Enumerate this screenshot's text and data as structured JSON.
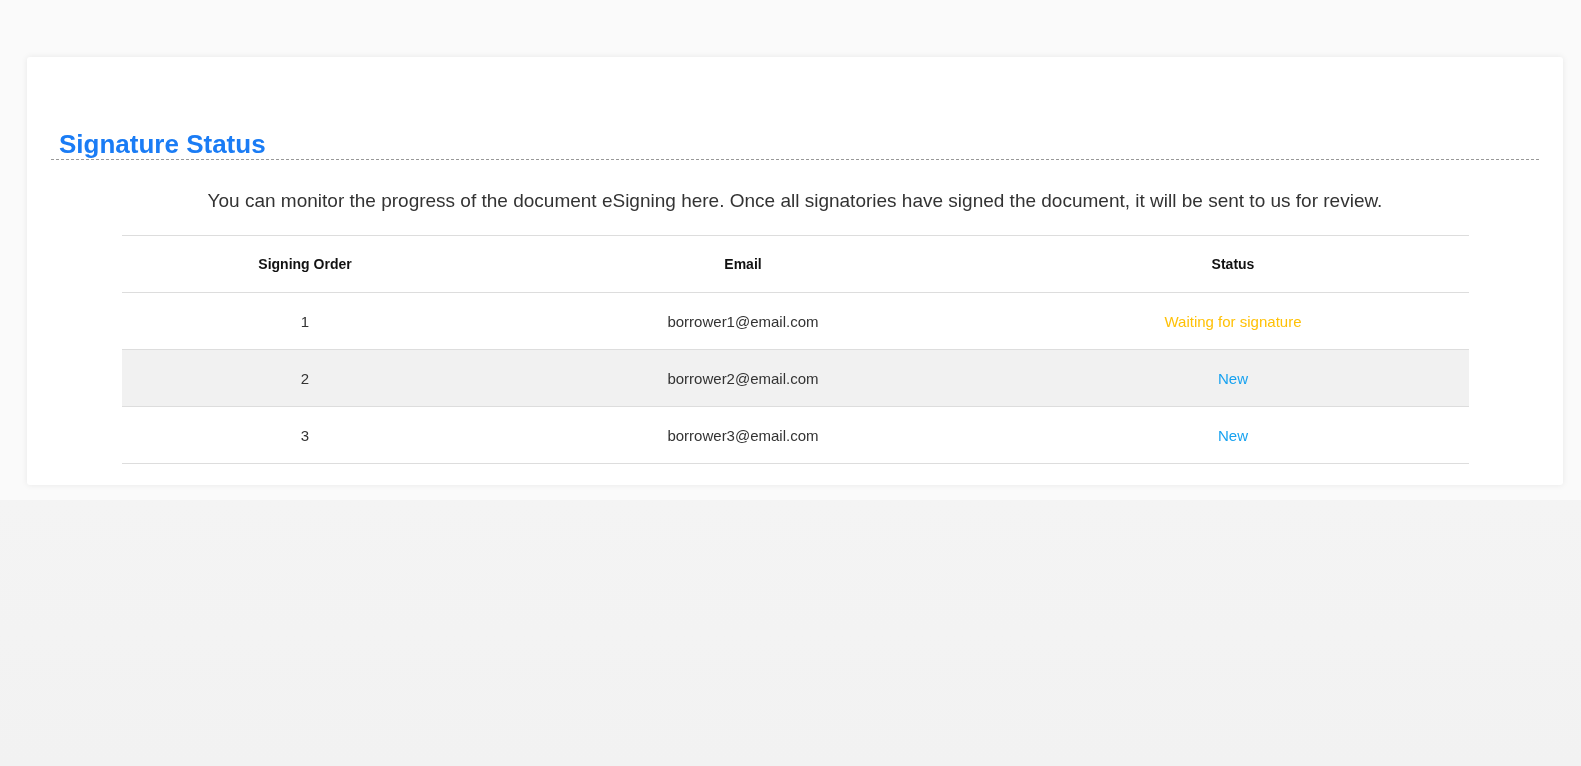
{
  "title": "Signature Status",
  "description": "You can monitor the progress of the document eSigning here. Once all signatories have signed the document, it will be sent to us for review.",
  "table": {
    "columns": [
      "Signing Order",
      "Email",
      "Status"
    ],
    "rows": [
      {
        "order": "1",
        "email": "borrower1@email.com",
        "status": "Waiting for signature",
        "color": "#ffc107"
      },
      {
        "order": "2",
        "email": "borrower2@email.com",
        "status": "New",
        "color": "#17a2f0"
      },
      {
        "order": "3",
        "email": "borrower3@email.com",
        "status": "New",
        "color": "#17a2f0"
      }
    ]
  }
}
